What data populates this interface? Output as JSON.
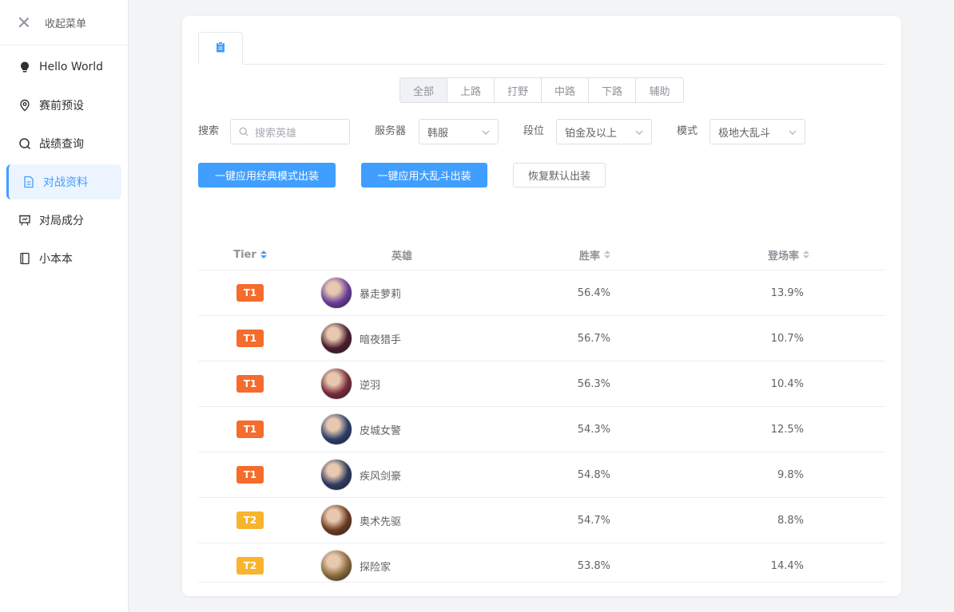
{
  "sidebar": {
    "collapse_label": "收起菜单",
    "items": [
      {
        "label": "Hello World",
        "icon": "bulb-icon",
        "active": false
      },
      {
        "label": "赛前预设",
        "icon": "location-icon",
        "active": false
      },
      {
        "label": "战绩查询",
        "icon": "search-icon",
        "active": false
      },
      {
        "label": "对战资料",
        "icon": "document-icon",
        "active": true
      },
      {
        "label": "对局成分",
        "icon": "presentation-icon",
        "active": false
      },
      {
        "label": "小本本",
        "icon": "notebook-icon",
        "active": false
      }
    ]
  },
  "tab": {
    "icon": "clipboard-icon"
  },
  "positions": {
    "options": [
      "全部",
      "上路",
      "打野",
      "中路",
      "下路",
      "辅助"
    ],
    "selected": "全部"
  },
  "filters": {
    "search_label": "搜索",
    "search_placeholder": "搜索英雄",
    "server_label": "服务器",
    "server_value": "韩服",
    "rank_label": "段位",
    "rank_value": "铂金及以上",
    "mode_label": "模式",
    "mode_value": "极地大乱斗"
  },
  "buttons": {
    "apply_classic": "一键应用经典模式出装",
    "apply_aram": "一键应用大乱斗出装",
    "restore_default": "恢复默认出装"
  },
  "table": {
    "columns": {
      "tier": "Tier",
      "hero": "英雄",
      "win_rate": "胜率",
      "pick_rate": "登场率"
    },
    "rows": [
      {
        "tier": "T1",
        "hero": "暴走萝莉",
        "win_rate": "56.4%",
        "pick_rate": "13.9%"
      },
      {
        "tier": "T1",
        "hero": "暗夜猎手",
        "win_rate": "56.7%",
        "pick_rate": "10.7%"
      },
      {
        "tier": "T1",
        "hero": "逆羽",
        "win_rate": "56.3%",
        "pick_rate": "10.4%"
      },
      {
        "tier": "T1",
        "hero": "皮城女警",
        "win_rate": "54.3%",
        "pick_rate": "12.5%"
      },
      {
        "tier": "T1",
        "hero": "疾风剑豪",
        "win_rate": "54.8%",
        "pick_rate": "9.8%"
      },
      {
        "tier": "T2",
        "hero": "奥术先驱",
        "win_rate": "54.7%",
        "pick_rate": "8.8%"
      },
      {
        "tier": "T2",
        "hero": "探险家",
        "win_rate": "53.8%",
        "pick_rate": "14.4%"
      }
    ]
  },
  "colors": {
    "accent": "#409eff",
    "tier_t1": "#f56c2c",
    "tier_t2": "#f7b42c",
    "avatars": [
      "#6a3d9a",
      "#4a1d2e",
      "#7a2a3a",
      "#2c3e6a",
      "#2e3a5e",
      "#6b3a1e",
      "#8a6a3a"
    ]
  }
}
